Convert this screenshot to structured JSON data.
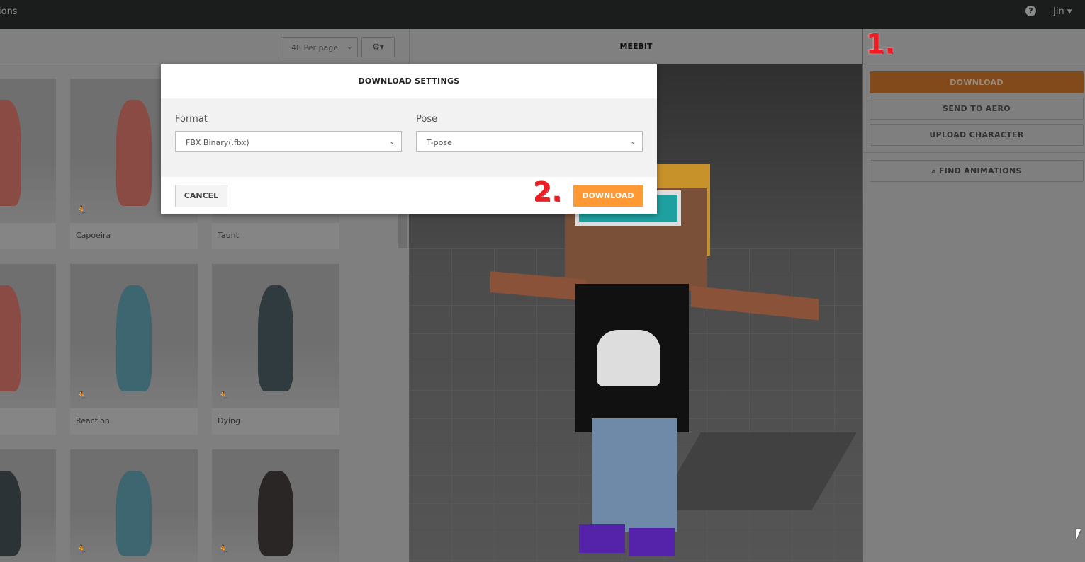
{
  "topbar": {
    "nav_partial": "ions",
    "help_icon": "question-circle-icon",
    "user": "Jin ▾"
  },
  "toolbar": {
    "per_page": "48 Per page",
    "settings_icon": "gear-icon"
  },
  "cards": [
    {
      "label": ""
    },
    {
      "label": "Capoeira"
    },
    {
      "label": "Taunt"
    },
    {
      "label": ""
    },
    {
      "label": "Reaction"
    },
    {
      "label": "Dying"
    },
    {
      "label": ""
    },
    {
      "label": ""
    },
    {
      "label": ""
    }
  ],
  "viewer": {
    "title": "MEEBIT"
  },
  "right_panel": {
    "download": "DOWNLOAD",
    "send_to_aero": "SEND TO AERO",
    "upload_character": "UPLOAD CHARACTER",
    "find_animations": "FIND ANIMATIONS",
    "accent": "#ff9933"
  },
  "annotations": {
    "step1": "1.",
    "step2": "2.",
    "color": "#ee1c24"
  },
  "modal": {
    "title": "DOWNLOAD SETTINGS",
    "format_label": "Format",
    "format_value": "FBX Binary(.fbx)",
    "pose_label": "Pose",
    "pose_value": "T-pose",
    "cancel": "CANCEL",
    "download": "DOWNLOAD"
  }
}
